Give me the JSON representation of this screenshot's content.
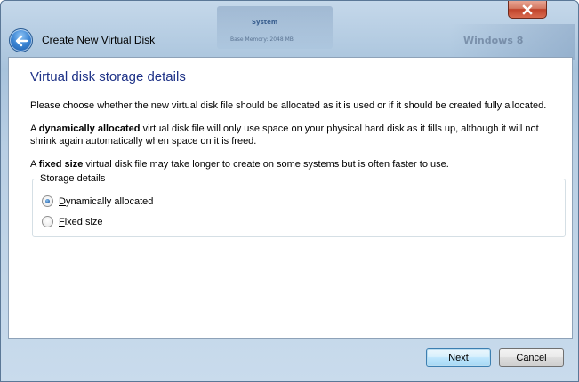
{
  "window": {
    "title": "Create New Virtual Disk",
    "close_icon": "close-icon",
    "back_icon": "back-arrow-icon",
    "background_glimpses": [
      "System",
      "Base Memory: 2048 MB",
      "Windows 8"
    ]
  },
  "page": {
    "heading": "Virtual disk storage details",
    "intro": "Please choose whether the new virtual disk file should be allocated as it is used or if it should be created fully allocated.",
    "dynamic_desc": {
      "prefix": "A ",
      "bold": "dynamically allocated",
      "suffix": " virtual disk file will only use space on your physical hard disk as it fills up, although it will not shrink again automatically when space on it is freed."
    },
    "fixed_desc": {
      "prefix": "A ",
      "bold": "fixed size",
      "suffix": " virtual disk file may take longer to create on some systems but is often faster to use."
    }
  },
  "storage": {
    "group_label": "Storage details",
    "options": [
      {
        "mnemonic": "D",
        "rest": "ynamically allocated",
        "selected": true
      },
      {
        "mnemonic": "F",
        "rest": "ixed size",
        "selected": false
      }
    ]
  },
  "buttons": {
    "next": {
      "mnemonic": "N",
      "rest": "ext"
    },
    "cancel": "Cancel"
  },
  "colors": {
    "heading": "#1e3287",
    "close_button": "#c0432b",
    "default_button_border": "#3c7fb1"
  }
}
